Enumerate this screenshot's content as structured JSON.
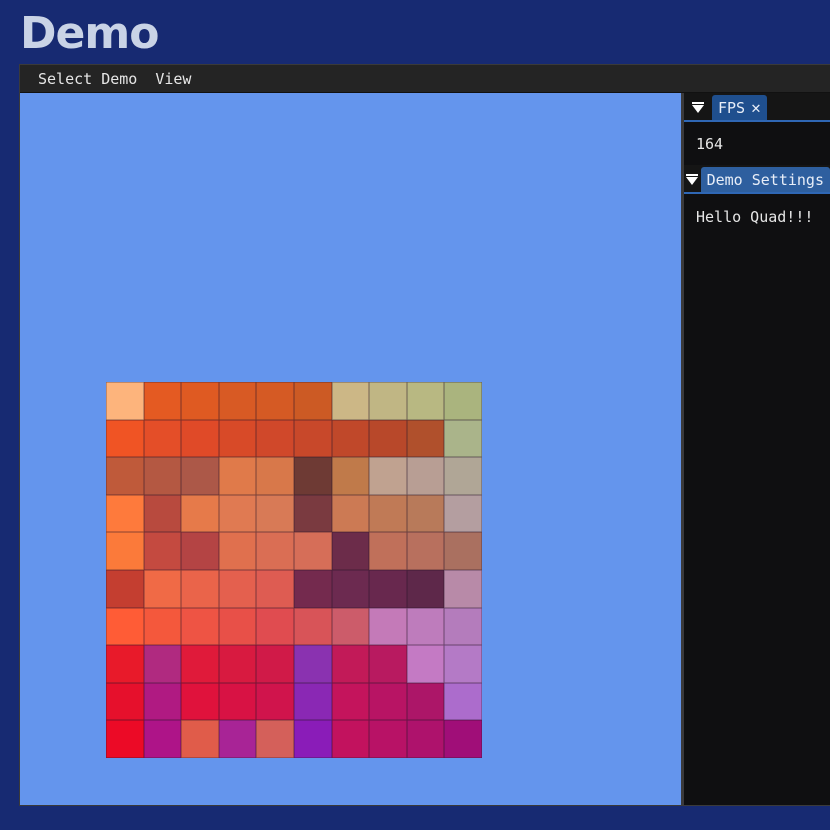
{
  "app": {
    "title": "Demo"
  },
  "menubar": {
    "items": [
      "Select Demo",
      "View"
    ]
  },
  "fps_panel": {
    "tab_label": "FPS",
    "close_symbol": "✕",
    "value": "164"
  },
  "settings_panel": {
    "tab_label": "Demo Settings",
    "message": "Hello Quad!!!"
  },
  "viewport": {
    "background": "#6495ed",
    "quad_colors": [
      [
        "#fdb47c",
        "#e45a22",
        "#df5a22",
        "#d85a24",
        "#d55a24",
        "#cc5a24",
        "#ccb786",
        "#c0b684",
        "#b8b882",
        "#aab47e"
      ],
      [
        "#f05424",
        "#e44e28",
        "#e04a28",
        "#d84a28",
        "#d0482a",
        "#c8482a",
        "#c0482a",
        "#b8482a",
        "#b0502c",
        "#aab48a"
      ],
      [
        "#bf5a3a",
        "#b45842",
        "#ac5848",
        "#e07a4a",
        "#d8784a",
        "#6e3a34",
        "#c07a4a",
        "#c0a290",
        "#b89e94",
        "#b0a696"
      ],
      [
        "#fe7a3c",
        "#b84a3e",
        "#e67a4a",
        "#e07a52",
        "#d87a56",
        "#7a3a40",
        "#cc7a54",
        "#c07a56",
        "#b87a5a",
        "#b49ea0"
      ],
      [
        "#fb7a3a",
        "#c44a40",
        "#b44444",
        "#e0704e",
        "#da6e54",
        "#d66e58",
        "#6c2c4a",
        "#c0705a",
        "#b8705e",
        "#aa7060"
      ],
      [
        "#c43e30",
        "#f06a46",
        "#ea644a",
        "#e4604e",
        "#de5c52",
        "#742a4e",
        "#6c2a50",
        "#68284e",
        "#5e284a",
        "#b88aa8"
      ],
      [
        "#ff5c36",
        "#f4583c",
        "#ee5444",
        "#e85048",
        "#e04c50",
        "#d85458",
        "#cc5c6a",
        "#c47ab8",
        "#be7cbc",
        "#b47cbc"
      ],
      [
        "#e81a2a",
        "#b02a80",
        "#e01a3a",
        "#d81a40",
        "#d01a48",
        "#8a32b0",
        "#c21a58",
        "#b81a60",
        "#c47ac4",
        "#b47ac6"
      ],
      [
        "#e6102c",
        "#b01a82",
        "#e0123c",
        "#d81244",
        "#d0144c",
        "#8a28b4",
        "#c4145c",
        "#b81464",
        "#ac1668",
        "#ac6ccc"
      ],
      [
        "#ec0a26",
        "#ae1488",
        "#e05c4a",
        "#a82496",
        "#d4605a",
        "#8a1cb8",
        "#c2125e",
        "#b81266",
        "#ae126c",
        "#a00e78"
      ]
    ]
  },
  "colors": {
    "page_background": "#172a72",
    "title_text": "#c9d3e6",
    "menubar": "#242424",
    "dock_background": "#0f0f11",
    "tab_active": "#2e5f9f",
    "tab_border": "#2f67b5"
  },
  "icons": {
    "collapse": "triangle-down-icon",
    "close": "close-icon"
  }
}
